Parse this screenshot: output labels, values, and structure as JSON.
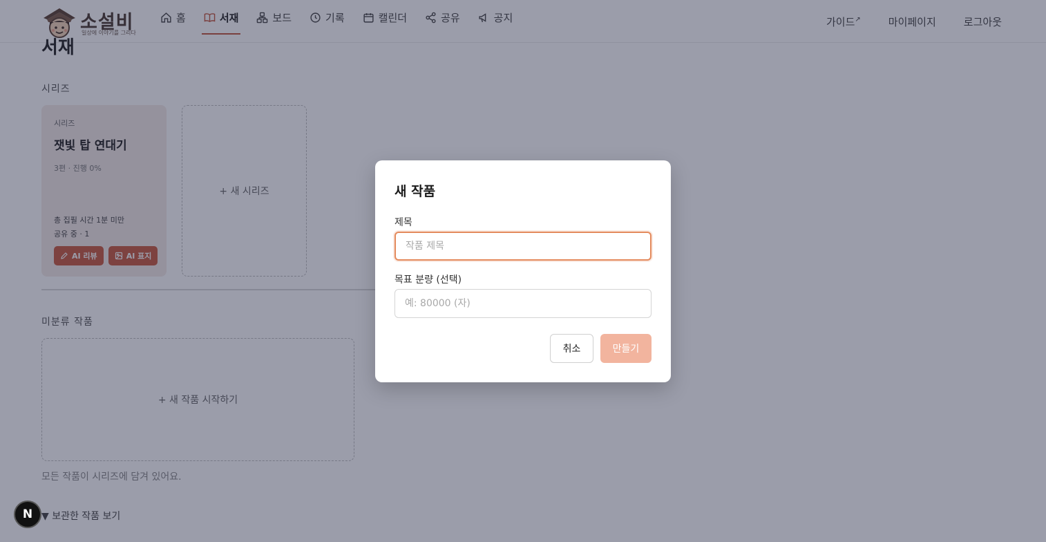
{
  "app": {
    "logo_text": "소설비",
    "logo_sub": "일상에 이야기를 그리다"
  },
  "nav": {
    "items": [
      {
        "label": "홈",
        "icon": "home-icon"
      },
      {
        "label": "서재",
        "icon": "book-icon",
        "active": true
      },
      {
        "label": "보드",
        "icon": "board-icon"
      },
      {
        "label": "기록",
        "icon": "clock-icon"
      },
      {
        "label": "캘린더",
        "icon": "calendar-icon"
      },
      {
        "label": "공유",
        "icon": "share-icon"
      },
      {
        "label": "공지",
        "icon": "megaphone-icon"
      }
    ],
    "right": {
      "guide": "가이드",
      "guide_mark": "↗",
      "mypage": "마이페이지",
      "logout": "로그아웃"
    }
  },
  "page": {
    "title": "서재",
    "series_section": "시리즈",
    "series_card": {
      "kicker": "시리즈",
      "title": "잿빛 탑 연대기",
      "meta": "3편 · 진행 0%",
      "stat_time": "총 집필 시간 1분 미만",
      "stat_share": "공유 중 · 1",
      "btn_review": "AI 리뷰",
      "btn_cover": "AI 표지"
    },
    "new_series": "+ 새 시리즈",
    "unsorted_section": "미분류 작품",
    "new_work": "+ 새 작품 시작하기",
    "all_in_series": "모든 작품이 시리즈에 담겨 있어요.",
    "archived_toggle": "▼ 보관한 작품 보기"
  },
  "modal": {
    "title": "새 작품",
    "title_label": "제목",
    "title_placeholder": "작품 제목",
    "title_value": "",
    "goal_label": "목표 분량 (선택)",
    "goal_placeholder": "예: 80000 (자)",
    "goal_value": "",
    "cancel": "취소",
    "create": "만들기"
  },
  "badge": {
    "letter": "N"
  },
  "colors": {
    "accent": "#c4563d",
    "primary_disabled": "#f2b49e",
    "focus_ring": "#e48a5c",
    "overlay": "rgba(33,38,66,0.45)"
  }
}
